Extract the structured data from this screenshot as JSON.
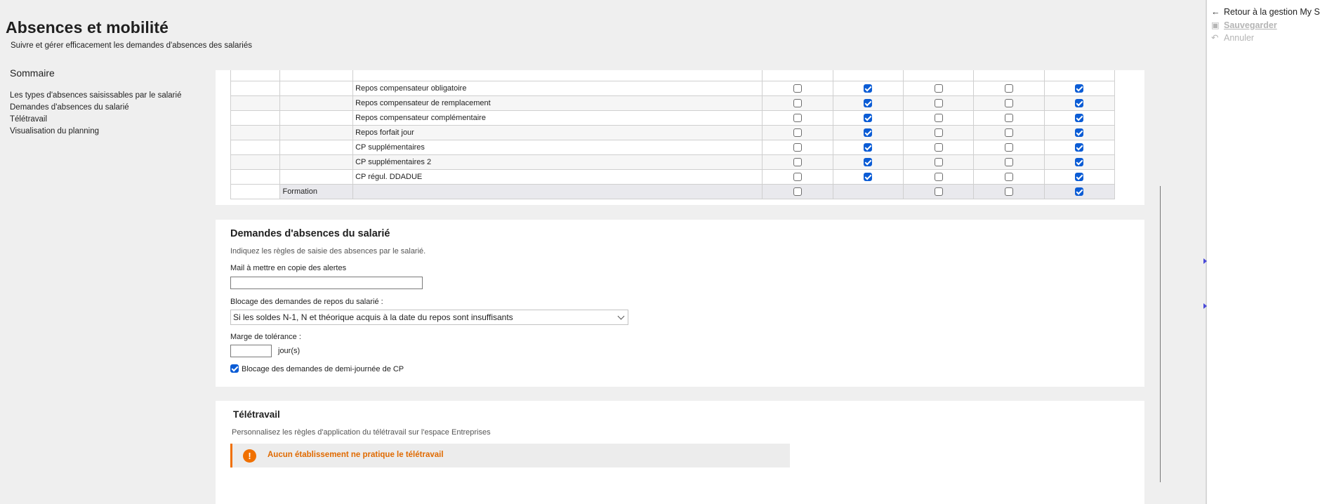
{
  "header": {
    "title": "Absences et mobilité",
    "subtitle": "Suivre et gérer efficacement les demandes d'absences des salariés"
  },
  "sommaire": {
    "title": "Sommaire",
    "items": [
      "Les types d'absences saisissables par le salarié",
      "Demandes d'absences du salarié",
      "Télétravail",
      "Visualisation du planning"
    ]
  },
  "table": {
    "rows": [
      {
        "label": "Repos compensateur obligatoire",
        "checks": [
          false,
          true,
          false,
          false,
          true
        ]
      },
      {
        "label": "Repos compensateur de remplacement",
        "checks": [
          false,
          true,
          false,
          false,
          true
        ]
      },
      {
        "label": "Repos compensateur complémentaire",
        "checks": [
          false,
          true,
          false,
          false,
          true
        ]
      },
      {
        "label": "Repos forfait jour",
        "checks": [
          false,
          true,
          false,
          false,
          true
        ]
      },
      {
        "label": "CP supplémentaires",
        "checks": [
          false,
          true,
          false,
          false,
          true
        ]
      },
      {
        "label": "CP supplémentaires 2",
        "checks": [
          false,
          true,
          false,
          false,
          true
        ]
      },
      {
        "label": "CP régul. DDADUE",
        "checks": [
          false,
          true,
          false,
          false,
          true
        ]
      }
    ],
    "formation": {
      "label": "Formation",
      "checks": [
        false,
        null,
        false,
        false,
        true
      ]
    }
  },
  "demandes": {
    "title": "Demandes d'absences du salarié",
    "description": "Indiquez les règles de saisie des absences par le salarié.",
    "mail_label": "Mail à mettre en copie des alertes",
    "mail_value": "",
    "blocage_label": "Blocage des demandes de repos du salarié :",
    "blocage_value": "Si les soldes N-1, N et théorique acquis à la date du repos sont insuffisants",
    "marge_label": "Marge de tolérance :",
    "marge_value": "",
    "marge_unit": "jour(s)",
    "demi_journee_label": "Blocage des demandes de demi-journée de CP",
    "demi_journee_checked": true
  },
  "teletravail": {
    "title": "Télétravail",
    "description": "Personnalisez les règles d'application du télétravail sur l'espace Entreprises",
    "alert_icon": "!",
    "alert_message": "Aucun établissement ne pratique le télétravail"
  },
  "right_panel": {
    "back_label": "Retour à la gestion My Sila",
    "save_label": "Sauvegarder",
    "cancel_label": "Annuler",
    "back_icon": "arrow-left-icon",
    "save_icon": "save-icon",
    "cancel_icon": "undo-icon"
  },
  "colors": {
    "accent_blue": "#0b5cd5",
    "alert_orange": "#f07000"
  }
}
